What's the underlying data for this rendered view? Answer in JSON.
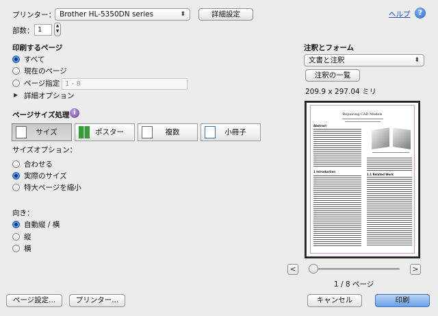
{
  "header": {
    "printer_label": "プリンター：",
    "printer_value": "Brother HL-5350DN series",
    "details_button": "詳細設定",
    "help_link": "ヘルプ",
    "copies_label": "部数：",
    "copies_value": "1"
  },
  "pages": {
    "heading": "印刷するページ",
    "options": [
      "すべて",
      "現在のページ",
      "ページ指定"
    ],
    "range_placeholder": "1 - 8",
    "detail_options": "詳細オプション"
  },
  "page_size": {
    "heading": "ページサイズ処理",
    "segments": [
      "サイズ",
      "ポスター",
      "複数",
      "小冊子"
    ],
    "size_options_label": "サイズオプション：",
    "size_options": [
      "合わせる",
      "実際のサイズ",
      "特大ページを縮小"
    ]
  },
  "orientation": {
    "label": "向き：",
    "options": [
      "自動縦 / 横",
      "縦",
      "横"
    ]
  },
  "annotations": {
    "heading": "注釈とフォーム",
    "select_value": "文書と注釈",
    "list_button": "注釈の一覧",
    "paper_size": "209.9 x 297.04 ミリ"
  },
  "preview": {
    "page_indicator": "1 / 8 ページ",
    "prev_glyph": "<",
    "next_glyph": ">",
    "doc_title": "Repairing CAD Models",
    "abstract_heading": "Abstract",
    "section_intro": "1 Introduction",
    "section_related": "1.1 Related Work"
  },
  "footer": {
    "page_setup": "ページ設定...",
    "printer": "プリンター...",
    "cancel": "キャンセル",
    "print": "印刷"
  },
  "colors": {
    "accent": "#2f6cc4",
    "help_link": "#1a4fd6",
    "print_button": "#6aa0e6"
  }
}
